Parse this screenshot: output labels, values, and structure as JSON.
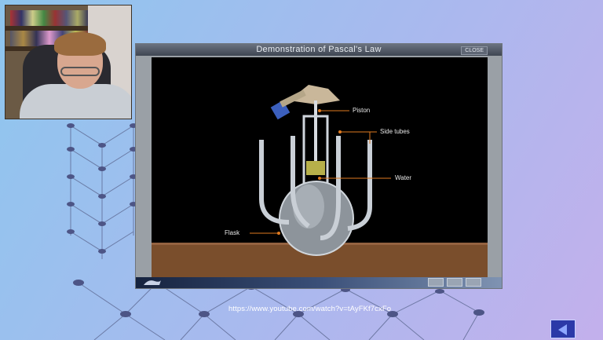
{
  "slide": {
    "footer_url": "https://www.youtube.com/watch?v=tAyFKf7cxFo",
    "nav": {
      "back_icon": "back-arrow-icon"
    }
  },
  "webcam": {
    "subject": "presenter-video"
  },
  "app": {
    "title": "Demonstration of Pascal's Law",
    "close_label": "CLOSE",
    "labels": {
      "piston": "Piston",
      "side_tubes": "Side tubes",
      "water": "Water",
      "flask": "Flask"
    }
  },
  "colors": {
    "accent_orange": "#e07a1f",
    "window_gray": "#9aa0a6",
    "table_brown": "#7a4e2c",
    "nav_blue": "#2b39a8"
  }
}
